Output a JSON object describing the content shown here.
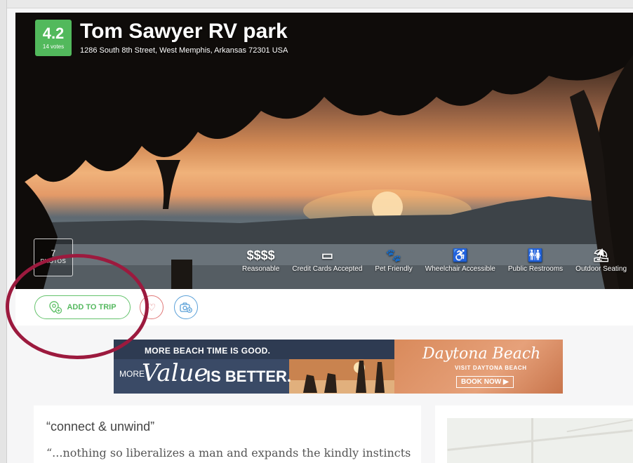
{
  "listing": {
    "rating": "4.2",
    "votes": "14 votes",
    "name": "Tom Sawyer RV park",
    "address": "1286 South 8th Street, West Memphis, Arkansas 72301 USA"
  },
  "photos": {
    "count": "7",
    "label": "PHOTOS"
  },
  "amenities": [
    {
      "icon": "price-icon",
      "glyph": "$$$$",
      "label": "Reasonable"
    },
    {
      "icon": "credit-card-icon",
      "glyph": "▭",
      "label": "Credit Cards Accepted"
    },
    {
      "icon": "paw-icon",
      "glyph": "🐾",
      "label": "Pet Friendly"
    },
    {
      "icon": "wheelchair-icon",
      "glyph": "♿",
      "label": "Wheelchair Accessible"
    },
    {
      "icon": "restroom-icon",
      "glyph": "🚻",
      "label": "Public Restrooms"
    },
    {
      "icon": "umbrella-table-icon",
      "glyph": "⛱",
      "label": "Outdoor Seating"
    }
  ],
  "actions": {
    "add_to_trip": "ADD TO TRIP",
    "heart_glyph": "♡",
    "photo_glyph": "📷"
  },
  "ad": {
    "line1": "MORE BEACH TIME IS GOOD.",
    "more": "MORE",
    "value": "Value",
    "is_better": "IS BETTER.",
    "brand": "Daytona Beach",
    "visit": "VISIT DAYTONA BEACH",
    "cta": "BOOK NOW ▶"
  },
  "review": {
    "title": "“connect & unwind”",
    "excerpt": "“...nothing so liberalizes a man and expands the kindly instincts"
  },
  "colors": {
    "rating_green": "#52b95c",
    "annotation_red": "#9c1a3e",
    "trip_green": "#64c36c"
  }
}
